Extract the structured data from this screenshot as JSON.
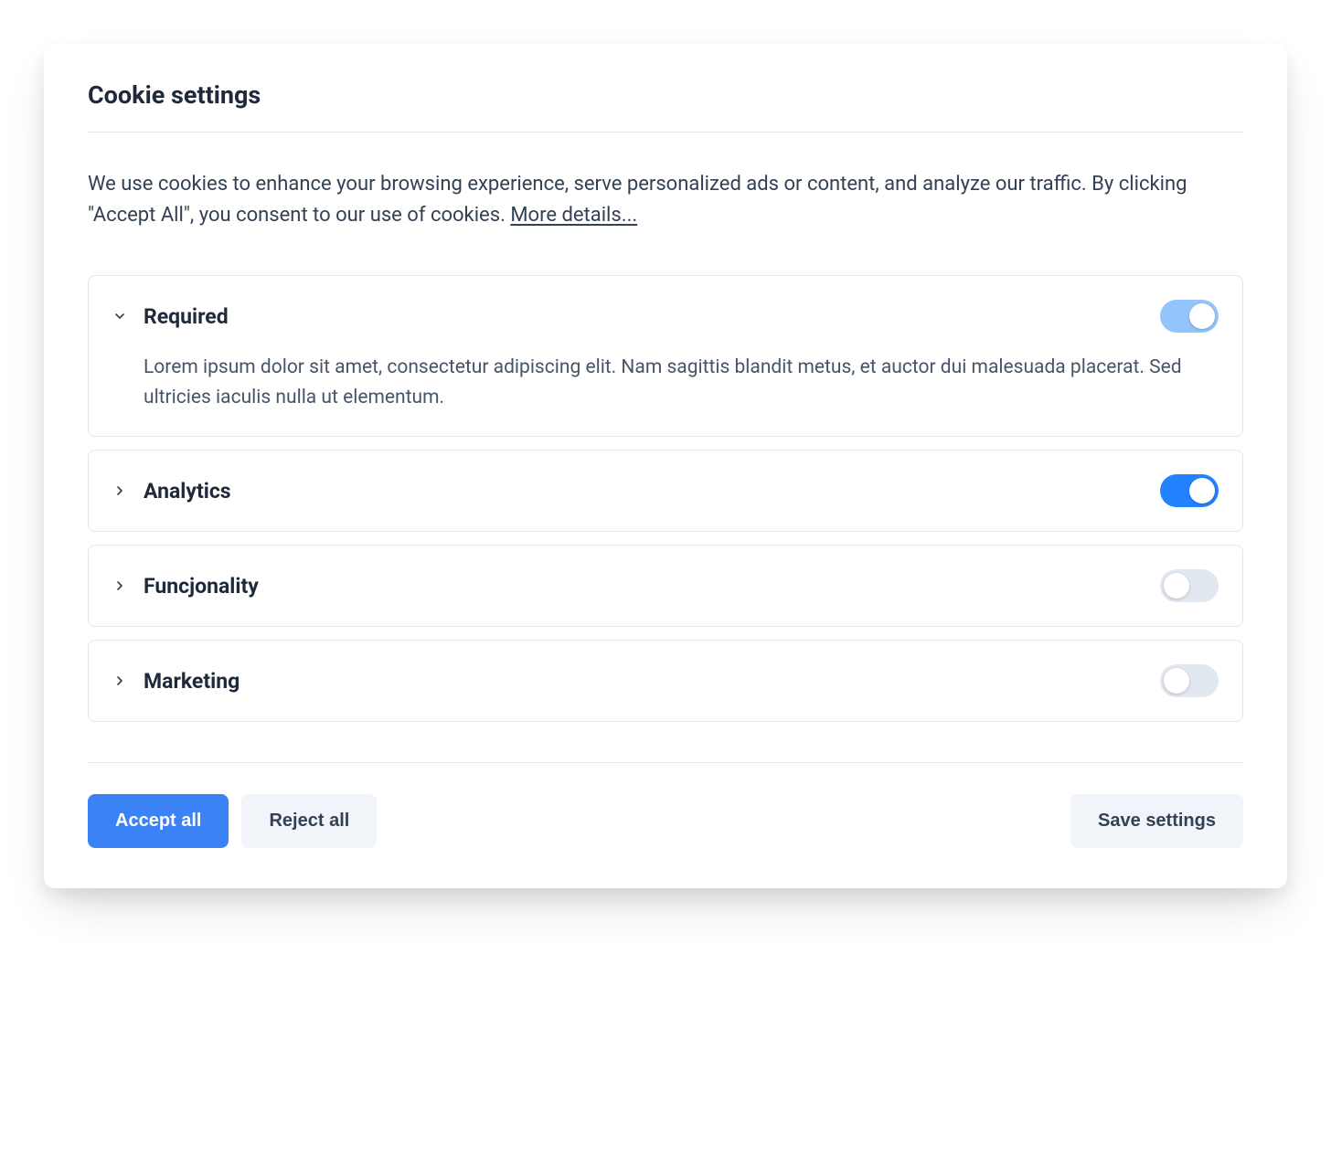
{
  "title": "Cookie settings",
  "description_text": "We use cookies to enhance your browsing experience, serve personalized ads or content, and analyze our traffic. By clicking \"Accept All\", you consent to our use of cookies. ",
  "more_link": "More details...",
  "categories": [
    {
      "name": "Required",
      "expanded": true,
      "toggle_state": "on-disabled",
      "description": "Lorem ipsum dolor sit amet, consectetur adipiscing elit. Nam sagittis blandit metus, et auctor dui malesuada placerat. Sed ultricies iaculis nulla ut elementum."
    },
    {
      "name": "Analytics",
      "expanded": false,
      "toggle_state": "on"
    },
    {
      "name": "Funcjonality",
      "expanded": false,
      "toggle_state": "off"
    },
    {
      "name": "Marketing",
      "expanded": false,
      "toggle_state": "off"
    }
  ],
  "buttons": {
    "accept_all": "Accept all",
    "reject_all": "Reject all",
    "save_settings": "Save settings"
  }
}
